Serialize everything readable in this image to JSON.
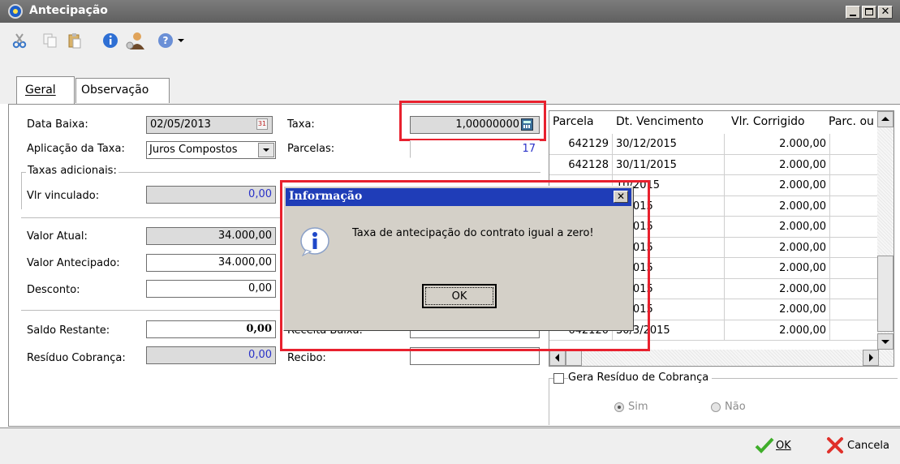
{
  "window": {
    "title": "Antecipação"
  },
  "toolbar": {
    "icons": [
      "cut-icon",
      "copy-icon",
      "paste-icon",
      "info-icon",
      "user-icon",
      "help-icon",
      "dropdown-arrow-icon"
    ]
  },
  "tabs": [
    {
      "label": "Geral"
    },
    {
      "label": "Observação"
    }
  ],
  "form": {
    "data_baixa_label": "Data Baixa:",
    "data_baixa_value": "02/05/2013",
    "aplicacao_label": "Aplicação da Taxa:",
    "aplicacao_value": "Juros Compostos",
    "taxas_adicionais_label": "Taxas adicionais:",
    "vlr_vinculado_label": "Vlr vinculado:",
    "vlr_vinculado_value": "0,00",
    "valor_atual_label": "Valor Atual:",
    "valor_atual_value": "34.000,00",
    "valor_antecipado_label": "Valor Antecipado:",
    "valor_antecipado_value": "34.000,00",
    "desconto_label": "Desconto:",
    "desconto_value": "0,00",
    "saldo_restante_label": "Saldo Restante:",
    "saldo_restante_value": "0,00",
    "residuo_label": "Resíduo Cobrança:",
    "residuo_value": "0,00",
    "taxa_label": "Taxa:",
    "taxa_value": "1,00000000",
    "parcelas_label": "Parcelas:",
    "parcelas_value": "17",
    "receita_label": "Receita Baixa:",
    "recibo_label": "Recibo:"
  },
  "grid": {
    "columns": [
      "Parcela",
      "Dt. Vencimento",
      "Vlr. Corrigido",
      "Parc. ou"
    ],
    "rows": [
      [
        "642129",
        "30/12/2015",
        "2.000,00",
        ""
      ],
      [
        "642128",
        "30/11/2015",
        "2.000,00",
        ""
      ],
      [
        "",
        "10/2015",
        "2.000,00",
        ""
      ],
      [
        "",
        "9/2015",
        "2.000,00",
        ""
      ],
      [
        "",
        "8/2015",
        "2.000,00",
        ""
      ],
      [
        "",
        "7/2015",
        "2.000,00",
        ""
      ],
      [
        "",
        "6/2015",
        "2.000,00",
        ""
      ],
      [
        "",
        "5/2015",
        "2.000,00",
        ""
      ],
      [
        "",
        "4/2015",
        "2.000,00",
        ""
      ],
      [
        "642120",
        "30/3/2015",
        "2.000,00",
        ""
      ]
    ]
  },
  "residuo_group": {
    "label": "Gera Resíduo de Cobrança",
    "sim": "Sim",
    "nao": "Não"
  },
  "dialog": {
    "title": "Informação",
    "message": "Taxa de antecipação do contrato igual a zero!",
    "ok": "OK"
  },
  "footer": {
    "ok": "OK",
    "ok_hotkey": "O",
    "cancel": "Cancela",
    "cancel_hotkey": "C"
  },
  "colors": {
    "title_bar": "#6e6e6e",
    "dialog_title": "#1f3db8",
    "highlight": "#e8212e",
    "link_blue": "#2a32c8"
  }
}
